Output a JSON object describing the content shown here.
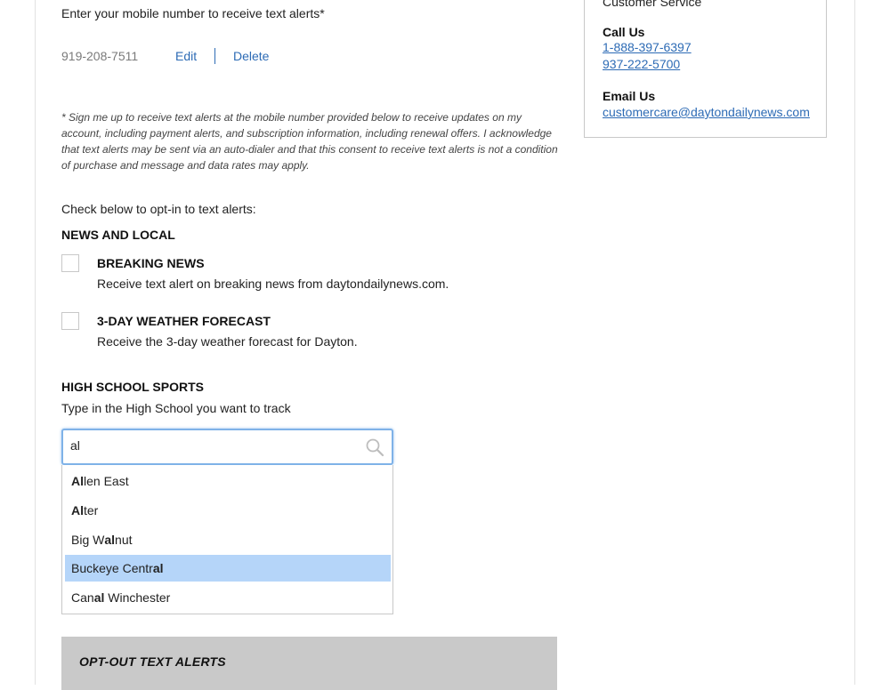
{
  "form": {
    "intro": "Enter your mobile number to receive text alerts*",
    "phone": "919-208-7511",
    "edit_label": "Edit",
    "delete_label": "Delete",
    "disclaimer": "* Sign me up to receive text alerts at the mobile number provided below to receive updates on my account, including payment alerts, and subscription information, including renewal offers. I acknowledge that text alerts may be sent via an auto-dialer and that this consent to receive text alerts is not a condition of purchase and message and data rates may apply.",
    "optin_intro": "Check below to opt-in to text alerts:"
  },
  "news": {
    "heading": "NEWS AND LOCAL",
    "options": [
      {
        "title": "BREAKING NEWS",
        "desc": "Receive text alert on breaking news from daytondailynews.com.",
        "checked": false
      },
      {
        "title": "3-DAY WEATHER FORECAST",
        "desc": "Receive the 3-day weather forecast for Dayton.",
        "checked": false
      }
    ]
  },
  "high_school": {
    "heading": "HIGH SCHOOL SPORTS",
    "desc": "Type in the High School you want to track",
    "search_value": "al",
    "search_icon": "magnifier-icon",
    "results": [
      {
        "before": "",
        "match": "Al",
        "after": "len East",
        "selected": false
      },
      {
        "before": "",
        "match": "Al",
        "after": "ter",
        "selected": false
      },
      {
        "before": "Big W",
        "match": "al",
        "after": "nut",
        "selected": false
      },
      {
        "before": "Buckeye Centr",
        "match": "al",
        "after": "",
        "selected": true
      },
      {
        "before": "Can",
        "match": "al",
        "after": " Winchester",
        "selected": false
      }
    ]
  },
  "optout": {
    "label": "OPT-OUT TEXT ALERTS"
  },
  "customer_service": {
    "title": "Customer Service",
    "call_label": "Call Us",
    "phones": [
      "1-888-397-6397",
      "937-222-5700"
    ],
    "email_label": "Email Us",
    "email": "customercare@daytondailynews.com"
  },
  "colors": {
    "link": "#2d6bb5",
    "highlight": "#b5d5f9",
    "focus_border": "#7fb2e8",
    "optout_bg": "#c9c9c9"
  }
}
